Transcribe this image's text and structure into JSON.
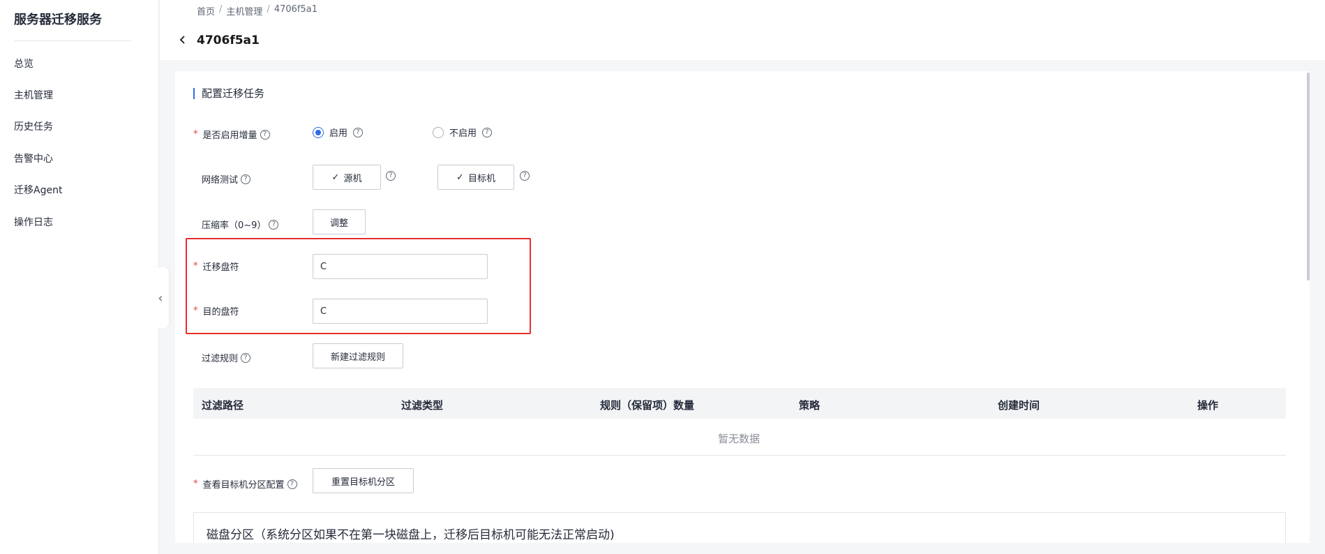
{
  "sidebar": {
    "title": "服务器迁移服务",
    "items": [
      {
        "label": "总览"
      },
      {
        "label": "主机管理"
      },
      {
        "label": "历史任务"
      },
      {
        "label": "告警中心"
      },
      {
        "label": "迁移Agent"
      },
      {
        "label": "操作日志"
      }
    ]
  },
  "breadcrumb": {
    "home": "首页",
    "host": "主机管理",
    "current": "4706f5a1",
    "sep": "/"
  },
  "page": {
    "title": "4706f5a1"
  },
  "section": {
    "title": "配置迁移任务"
  },
  "form": {
    "incremental": {
      "label": "是否启用增量",
      "enable": "启用",
      "disable": "不启用",
      "selected": "启用"
    },
    "network_test": {
      "label": "网络测试",
      "source_btn": "源机",
      "target_btn": "目标机"
    },
    "compression": {
      "label": "压缩率（0~9）",
      "button": "调整"
    },
    "source_drive": {
      "label": "迁移盘符",
      "value": "C"
    },
    "target_drive": {
      "label": "目的盘符",
      "value": "C"
    },
    "filter": {
      "label": "过滤规则",
      "button": "新建过滤规则"
    },
    "partition_config": {
      "label": "查看目标机分区配置",
      "button": "重置目标机分区"
    }
  },
  "table": {
    "columns": [
      "过滤路径",
      "过滤类型",
      "规则（保留项）数量",
      "策略",
      "创建时间",
      "操作"
    ],
    "empty": "暂无数据"
  },
  "partition": {
    "title": "磁盘分区（系统分区如果不在第一块磁盘上，迁移后目标机可能无法正常启动)"
  },
  "colors": {
    "accent": "#2e6be6",
    "required": "#e63d3d",
    "highlight": "#e52e2e"
  }
}
